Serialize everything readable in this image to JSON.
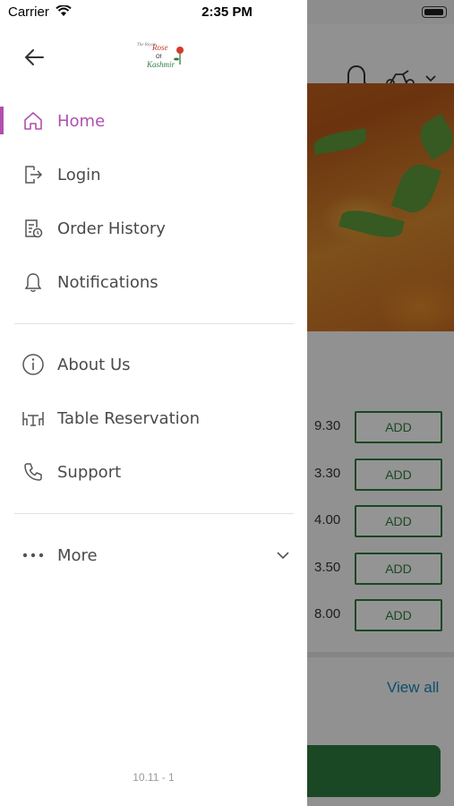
{
  "status_bar": {
    "carrier": "Carrier",
    "time": "2:35 PM"
  },
  "background": {
    "items": [
      {
        "price": "9.30",
        "button": "ADD"
      },
      {
        "price": "3.30",
        "button": "ADD"
      },
      {
        "price": "4.00",
        "button": "ADD"
      },
      {
        "price": "3.50",
        "button": "ADD"
      },
      {
        "price": "8.00",
        "button": "ADD"
      }
    ],
    "view_all": "View all"
  },
  "drawer": {
    "logo": {
      "line1": "The Royal",
      "line2": "Rose",
      "line3": "Of",
      "line4": "Kashmir"
    },
    "menu": [
      {
        "label": "Home",
        "icon": "home-icon",
        "active": true
      },
      {
        "label": "Login",
        "icon": "login-icon"
      },
      {
        "label": "Order History",
        "icon": "order-history-icon"
      },
      {
        "label": "Notifications",
        "icon": "bell-icon"
      },
      {
        "label": "About Us",
        "icon": "info-icon"
      },
      {
        "label": "Table Reservation",
        "icon": "table-icon"
      },
      {
        "label": "Support",
        "icon": "phone-icon"
      },
      {
        "label": "More",
        "icon": "more-icon"
      }
    ],
    "version": "10.11 - 1"
  },
  "colors": {
    "accent": "#b04fb0",
    "green": "#2e7d3e",
    "link": "#1a86b8"
  }
}
